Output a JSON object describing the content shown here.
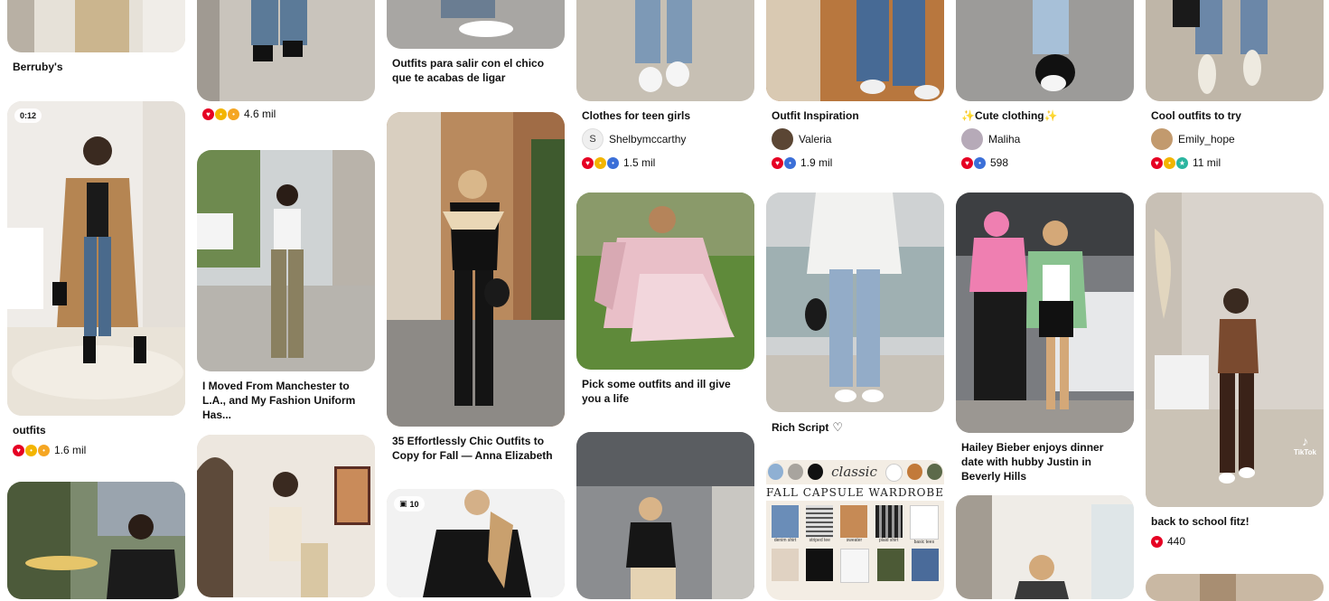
{
  "pins": [
    {
      "id": "c1a",
      "title": "Berruby's"
    },
    {
      "id": "c1b",
      "badge": "0:12",
      "title": "outfits",
      "reactions": [
        "heart",
        "wow",
        "face"
      ],
      "count": "1.6 mil"
    },
    {
      "id": "c1c"
    },
    {
      "id": "c2a",
      "reactions": [
        "heart",
        "wow",
        "face"
      ],
      "count": "4.6 mil"
    },
    {
      "id": "c2b",
      "title": "I Moved From Manchester to L.A., and My Fashion Uniform Has..."
    },
    {
      "id": "c2c"
    },
    {
      "id": "c3a",
      "title": "Outfits para salir con el chico que te acabas de ligar"
    },
    {
      "id": "c3b",
      "title": "35 Effortlessly Chic Outfits to Copy for Fall — Anna Elizabeth"
    },
    {
      "id": "c3c",
      "badge": "10"
    },
    {
      "id": "c4a",
      "title": "Clothes for teen girls",
      "author_initial": "S",
      "author": "Shelbymccarthy",
      "reactions": [
        "heart",
        "wow",
        "blue"
      ],
      "count": "1.5 mil"
    },
    {
      "id": "c4b",
      "title": "Pick some outfits and ill give you a life"
    },
    {
      "id": "c4c"
    },
    {
      "id": "c5a",
      "title": "Outfit Inspiration",
      "author": "Valeria",
      "reactions": [
        "heart",
        "blue"
      ],
      "count": "1.9 mil"
    },
    {
      "id": "c5b",
      "title": "Rich Script",
      "title_icon": "♡"
    },
    {
      "id": "c5c",
      "graphic_title": "classic",
      "graphic_subtitle": "FALL CAPSULE WARDROBE",
      "graphic_items": [
        "denim shirt",
        "striped tee",
        "sweater",
        "plaid shirt",
        "basic tees"
      ]
    },
    {
      "id": "c6a",
      "title": "✨Cute clothing✨",
      "author": "Maliha",
      "reactions": [
        "heart",
        "blue"
      ],
      "count": "598"
    },
    {
      "id": "c6b",
      "title": "Hailey Bieber enjoys dinner date with hubby Justin in Beverly Hills"
    },
    {
      "id": "c6c"
    },
    {
      "id": "c7a",
      "title": "Cool outfits to try",
      "author": "Emily_hope",
      "reactions": [
        "heart",
        "wow",
        "star"
      ],
      "count": "11 mil"
    },
    {
      "id": "c7b",
      "title": "back to school fitz!",
      "reactions": [
        "heart"
      ],
      "count": "440",
      "overlay": "TikTok"
    },
    {
      "id": "c7c"
    }
  ],
  "colors": {
    "heart": "#e60023",
    "accent": "#111111",
    "background": "#ffffff"
  }
}
